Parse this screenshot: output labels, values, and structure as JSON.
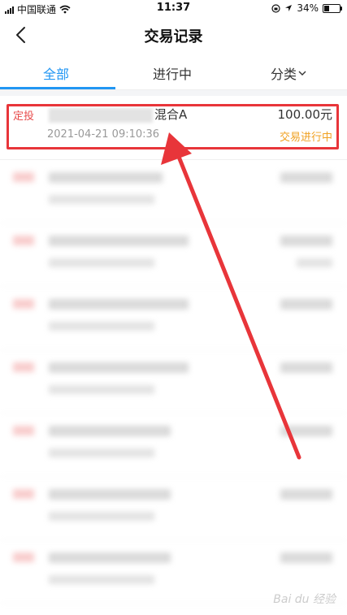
{
  "status_bar": {
    "carrier": "中国联通",
    "time": "11:37",
    "battery": "34%"
  },
  "nav": {
    "title": "交易记录"
  },
  "tabs": [
    {
      "label": "全部",
      "active": true
    },
    {
      "label": "进行中"
    },
    {
      "label": "分类"
    }
  ],
  "records": [
    {
      "type": "定投",
      "name": "混合A",
      "date": "2021-04-21 09:10:36",
      "amount": "100.00元",
      "status": "交易进行中"
    }
  ],
  "watermark": "Bai du 经验",
  "colors": {
    "accent": "#2196f3",
    "type_red": "#e84c4c",
    "status_orange": "#f0a020",
    "annotation_red": "#e8353a"
  }
}
